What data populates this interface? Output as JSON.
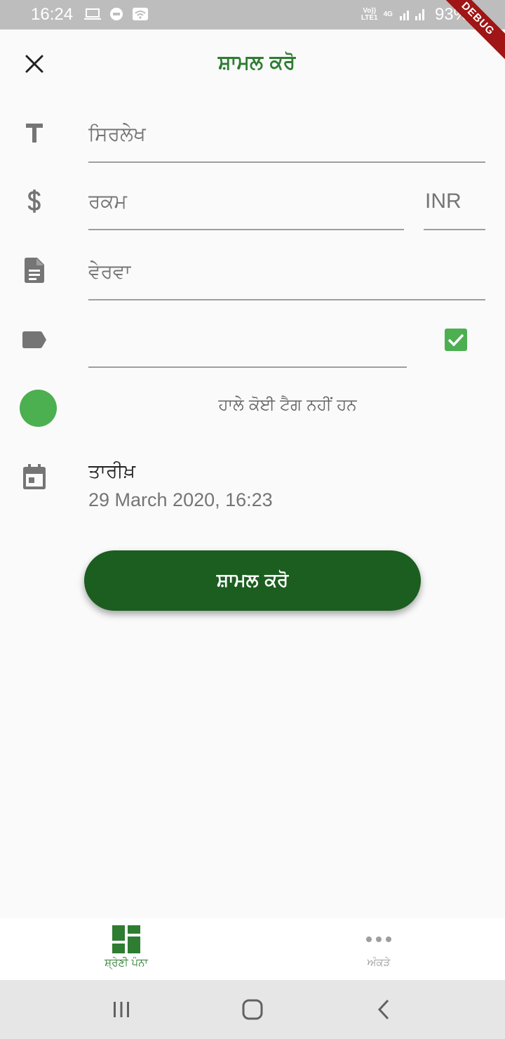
{
  "status_bar": {
    "time": "16:24",
    "network_top": "Vo))",
    "network_bottom": "LTE1",
    "network_type": "4G",
    "battery": "93%",
    "debug_label": "DEBUG",
    "icons": [
      "laptop-icon",
      "dex-icon",
      "wifi-icon",
      "signal-icon",
      "battery-icon"
    ]
  },
  "header": {
    "title": "ਸ਼ਾਮਲ ਕਰੋ",
    "close_icon": "close-icon"
  },
  "form": {
    "title_placeholder": "ਸਿਰਲੇਖ",
    "amount_placeholder": "ਰਕਮ",
    "currency": "INR",
    "description_placeholder": "ਵੇਰਵਾ",
    "tag_value": "",
    "tag_checked": true,
    "no_tags_text": "ਹਾਲੇ ਕੋਈ ਟੈਗ ਨਹੀਂ ਹਨ",
    "date_label": "ਤਾਰੀਖ਼",
    "date_value": "29 March 2020, 16:23",
    "submit_label": "ਸ਼ਾਮਲ ਕਰੋ"
  },
  "bottom_nav": {
    "items": [
      {
        "label": "ਸ਼੍ਰੇਣੀ ਪੰਨਾ",
        "icon": "dashboard-icon",
        "active": true
      },
      {
        "label": "ਅੰਕੜੇ",
        "icon": "more-horiz-icon",
        "active": false
      }
    ]
  },
  "colors": {
    "accent": "#2e7d32",
    "button": "#1b5e20",
    "checkbox": "#4caf50",
    "selected_color": "#4caf50"
  }
}
